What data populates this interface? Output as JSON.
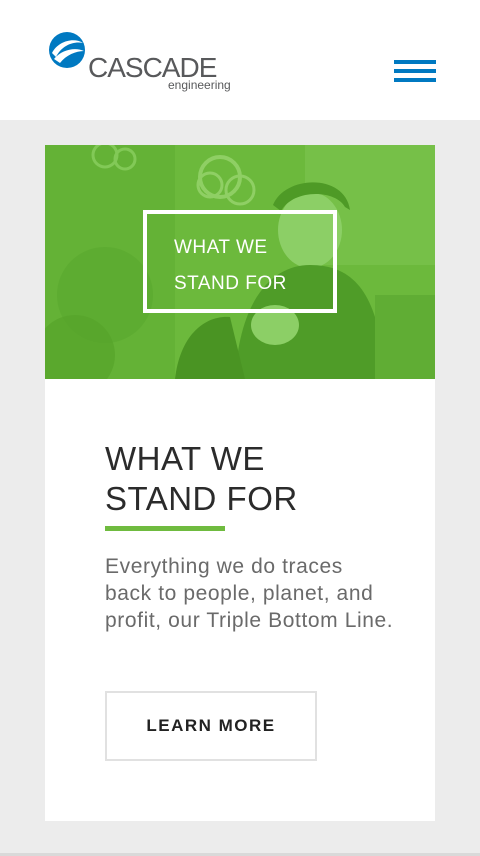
{
  "header": {
    "logo_name": "CASCADE",
    "logo_sub": "engineering",
    "logo_icon": "globe-swoosh-icon",
    "menu_icon": "hamburger-menu-icon",
    "brand_blue": "#0079c1",
    "logo_gray": "#58595b"
  },
  "hero": {
    "title": "WHAT WE STAND FOR",
    "overlay_color": "#6fbb3f"
  },
  "content": {
    "title": "WHAT WE STAND FOR",
    "body": "Everything we do traces back to people, planet, and profit, our Triple Bottom Line.",
    "cta_label": "LEARN MORE",
    "accent_color": "#6fbb3f"
  }
}
